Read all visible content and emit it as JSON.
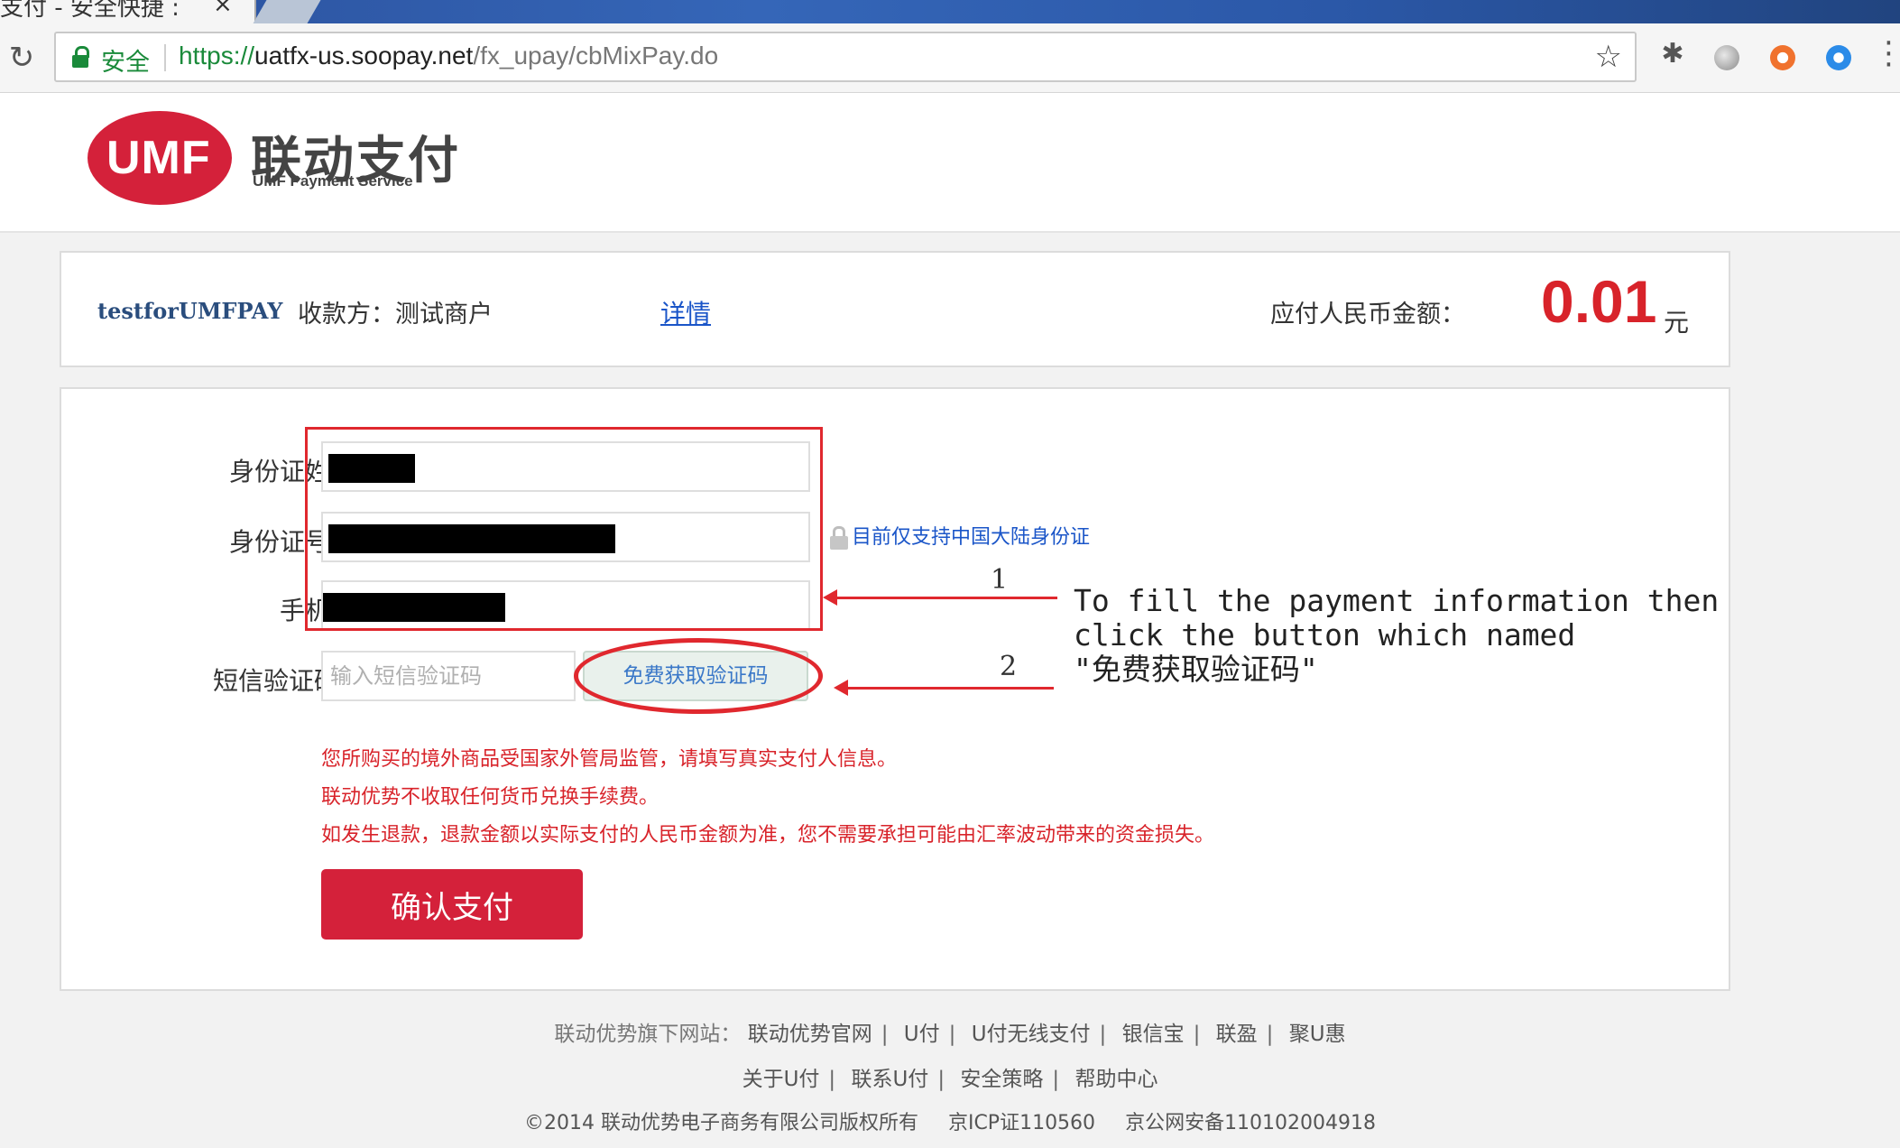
{
  "browser": {
    "tab_title": "支付 - 安全快捷 :",
    "tab_close": "×",
    "secure_label": "安全",
    "url_scheme": "https://",
    "url_host": "uatfx-us.soopay.net",
    "url_path": "/fx_upay/cbMixPay.do"
  },
  "header": {
    "logo_letters": "UMF",
    "logo_cn": "联动支付",
    "logo_en": "UMF Payment Service"
  },
  "merchant": {
    "id": "testforUMFPAY",
    "payee": "收款方：测试商户",
    "details_link": "详情",
    "amount_label": "应付人民币金额：",
    "amount": "0.01",
    "currency_unit": "元"
  },
  "form": {
    "name_label": "身份证姓名",
    "id_label": "身份证号码",
    "phone_label": "手机号",
    "sms_label": "短信验证码：",
    "sms_placeholder": "输入短信验证码",
    "get_code_button": "免费获取验证码",
    "id_note": "目前仅支持中国大陆身份证",
    "notices": [
      "您所购买的境外商品受国家外管局监管，请填写真实支付人信息。",
      "联动优势不收取任何货币兑换手续费。",
      "如发生退款，退款金额以实际支付的人民币金额为准，您不需要承担可能由汇率波动带来的资金损失。"
    ],
    "confirm_button": "确认支付"
  },
  "annotation": {
    "step1": "1",
    "step2": "2",
    "text": "To fill the payment information then\nclick the button which named\n\"免费获取验证码\""
  },
  "footer": {
    "sites_label": "联动优势旗下网站：",
    "sites": [
      "联动优势官网",
      "U付",
      "U付无线支付",
      "银信宝",
      "联盈",
      "聚U惠"
    ],
    "links": [
      "关于U付",
      "联系U付",
      "安全策略",
      "帮助中心"
    ],
    "copyright": "©2014 联动优势电子商务有限公司版权所有",
    "icp": "京ICP证110560",
    "police": "京公网安备110102004918"
  }
}
